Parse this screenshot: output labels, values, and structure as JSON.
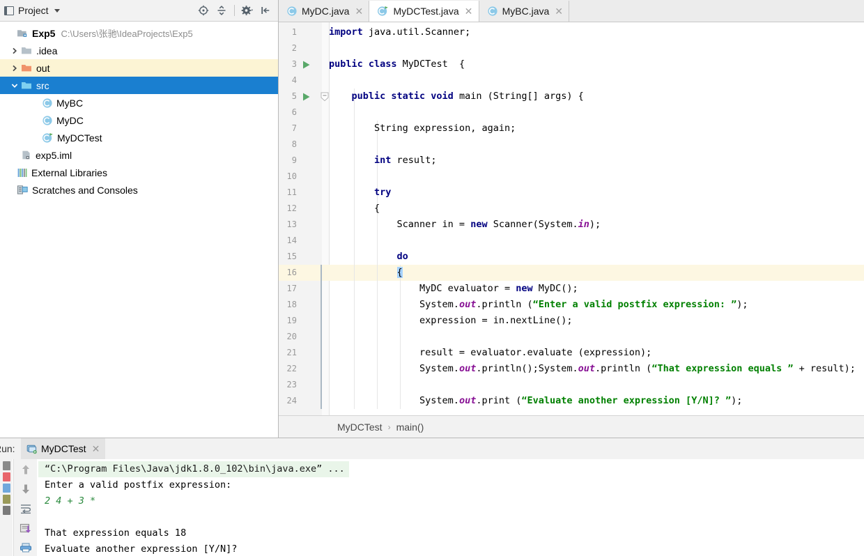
{
  "ide": {
    "project_panel": {
      "title": "Project",
      "title_icon": "project-window-icon",
      "caret_icon": "chevron-down-icon",
      "toolbar": [
        {
          "name": "locate-icon",
          "label": "Select Opened File"
        },
        {
          "name": "collapse-all-icon",
          "label": "Collapse All"
        },
        {
          "name": "gear-icon",
          "label": "Settings"
        },
        {
          "name": "hide-panel-icon",
          "label": "Hide"
        }
      ],
      "tree": [
        {
          "label": "Exp5",
          "secondary": "C:\\Users\\张驰\\IdeaProjects\\Exp5",
          "icon": "module-icon",
          "arrow": "none",
          "depth": 0,
          "state": "normal",
          "bold": true
        },
        {
          "label": ".idea",
          "secondary": "",
          "icon": "folder-grey-icon",
          "arrow": "right",
          "depth": 1,
          "state": "normal",
          "bold": false
        },
        {
          "label": "out",
          "secondary": "",
          "icon": "folder-orange-icon",
          "arrow": "right",
          "depth": 1,
          "state": "highlighted",
          "bold": false
        },
        {
          "label": "src",
          "secondary": "",
          "icon": "folder-source-icon",
          "arrow": "down",
          "depth": 1,
          "state": "selected",
          "bold": false
        },
        {
          "label": "MyBC",
          "secondary": "",
          "icon": "java-class-icon",
          "arrow": "none",
          "depth": 2,
          "state": "normal",
          "bold": false
        },
        {
          "label": "MyDC",
          "secondary": "",
          "icon": "java-class-icon",
          "arrow": "none",
          "depth": 2,
          "state": "normal",
          "bold": false
        },
        {
          "label": "MyDCTest",
          "secondary": "",
          "icon": "java-runnable-class-icon",
          "arrow": "none",
          "depth": 2,
          "state": "normal",
          "bold": false
        },
        {
          "label": "exp5.iml",
          "secondary": "",
          "icon": "iml-file-icon",
          "arrow": "none",
          "depth": 1,
          "state": "normal",
          "bold": false
        },
        {
          "label": "External Libraries",
          "secondary": "",
          "icon": "libraries-icon",
          "arrow": "none",
          "depth": 0,
          "state": "normal",
          "bold": false
        },
        {
          "label": "Scratches and Consoles",
          "secondary": "",
          "icon": "scratches-icon",
          "arrow": "none",
          "depth": 0,
          "state": "normal",
          "bold": false
        }
      ]
    },
    "editor": {
      "tabs": [
        {
          "label": "MyDC.java",
          "icon": "java-class-icon",
          "active": false,
          "close_icon": "close-icon"
        },
        {
          "label": "MyDCTest.java",
          "icon": "java-runnable-class-icon",
          "active": true,
          "close_icon": "close-icon"
        },
        {
          "label": "MyBC.java",
          "icon": "java-class-icon",
          "active": false,
          "close_icon": "close-icon"
        }
      ],
      "first_line": 1,
      "last_line": 24,
      "current_line": 16,
      "run_gutter_lines": [
        3,
        5
      ],
      "fold_gutter_lines": [
        5
      ],
      "lines": [
        {
          "n": 1,
          "html": "<span class=\"kw\">import</span> java.util.Scanner;"
        },
        {
          "n": 2,
          "html": ""
        },
        {
          "n": 3,
          "html": "<span class=\"kw\">public class</span> MyDCTest  {"
        },
        {
          "n": 4,
          "html": ""
        },
        {
          "n": 5,
          "html": "    <span class=\"kw\">public static void</span> main (String[] args) {"
        },
        {
          "n": 6,
          "html": ""
        },
        {
          "n": 7,
          "html": "        String expression, again;"
        },
        {
          "n": 8,
          "html": ""
        },
        {
          "n": 9,
          "html": "        <span class=\"kw\">int</span> result;"
        },
        {
          "n": 10,
          "html": ""
        },
        {
          "n": 11,
          "html": "        <span class=\"kw\">try</span>"
        },
        {
          "n": 12,
          "html": "        {"
        },
        {
          "n": 13,
          "html": "            Scanner in = <span class=\"kw\">new</span> Scanner(System.<span class=\"fld\">in</span>);"
        },
        {
          "n": 14,
          "html": ""
        },
        {
          "n": 15,
          "html": "            <span class=\"kw\">do</span>"
        },
        {
          "n": 16,
          "html": "            <span class=\"sel-ch\">{</span>"
        },
        {
          "n": 17,
          "html": "                MyDC evaluator = <span class=\"kw\">new</span> MyDC();"
        },
        {
          "n": 18,
          "html": "                System.<span class=\"fld\">out</span>.println (<span class=\"str\">“Enter a valid postfix expression: ”</span>);"
        },
        {
          "n": 19,
          "html": "                expression = in.nextLine();"
        },
        {
          "n": 20,
          "html": ""
        },
        {
          "n": 21,
          "html": "                result = evaluator.evaluate (expression);"
        },
        {
          "n": 22,
          "html": "                System.<span class=\"fld\">out</span>.println();System.<span class=\"fld\">out</span>.println (<span class=\"str\">“That expression equals ”</span> + result);"
        },
        {
          "n": 23,
          "html": ""
        },
        {
          "n": 24,
          "html": "                System.<span class=\"fld\">out</span>.print (<span class=\"str\">“Evaluate another expression [Y/N]? ”</span>);"
        }
      ],
      "plain_lines": [
        "import java.util.Scanner;",
        "",
        "public class MyDCTest  {",
        "",
        "    public static void main (String[] args) {",
        "",
        "        String expression, again;",
        "",
        "        int result;",
        "",
        "        try",
        "        {",
        "            Scanner in = new Scanner(System.in);",
        "",
        "            do",
        "            {",
        "                MyDC evaluator = new MyDC();",
        "                System.out.println (“Enter a valid postfix expression: ”);",
        "                expression = in.nextLine();",
        "",
        "                result = evaluator.evaluate (expression);",
        "                System.out.println();System.out.println (“That expression equals ” + result);",
        "",
        "                System.out.print (“Evaluate another expression [Y/N]? ”);"
      ],
      "breadcrumb": {
        "class_name": "MyDCTest",
        "separator": "›",
        "method_name": "main()"
      }
    },
    "run_panel": {
      "label": "Run:",
      "tab": {
        "label": "MyDCTest",
        "icon": "run-config-icon",
        "close_icon": "close-icon"
      },
      "toolbar": [
        {
          "name": "arrow-up-icon",
          "label": "Up the Stack Trace"
        },
        {
          "name": "arrow-down-icon",
          "label": "Down the Stack Trace"
        },
        {
          "name": "soft-wrap-icon",
          "label": "Use Soft Wraps"
        },
        {
          "name": "scroll-to-end-icon",
          "label": "Scroll to End"
        },
        {
          "name": "print-icon",
          "label": "Print"
        }
      ],
      "side_icons": [
        {
          "name": "rerun-icon",
          "label": "Rerun"
        },
        {
          "name": "stop-icon",
          "label": "Stop"
        },
        {
          "name": "resume-icon",
          "label": "Resume"
        },
        {
          "name": "trash-icon",
          "label": "Clear All"
        },
        {
          "name": "pin-icon",
          "label": "Pin Tab"
        }
      ],
      "console": [
        {
          "text": "“C:\\Program Files\\Java\\jdk1.8.0_102\\bin\\java.exe” ...",
          "kind": "command"
        },
        {
          "text": "Enter a valid postfix expression:",
          "kind": "output"
        },
        {
          "text": "2 4 + 3 *",
          "kind": "input"
        },
        {
          "text": "",
          "kind": "output"
        },
        {
          "text": "That expression equals 18",
          "kind": "output"
        },
        {
          "text": "Evaluate another expression [Y/N]?",
          "kind": "output"
        }
      ]
    },
    "colors": {
      "selection_blue": "#1a7fd0",
      "highlight_yellow": "#fcf4d4",
      "caret_line": "#fdf7e2",
      "keyword": "#000080",
      "string": "#008000",
      "field": "#871094",
      "console_command_bg": "#e9f5e9",
      "console_input": "#2b8a3e",
      "panel_grey": "#f2f2f2"
    }
  }
}
